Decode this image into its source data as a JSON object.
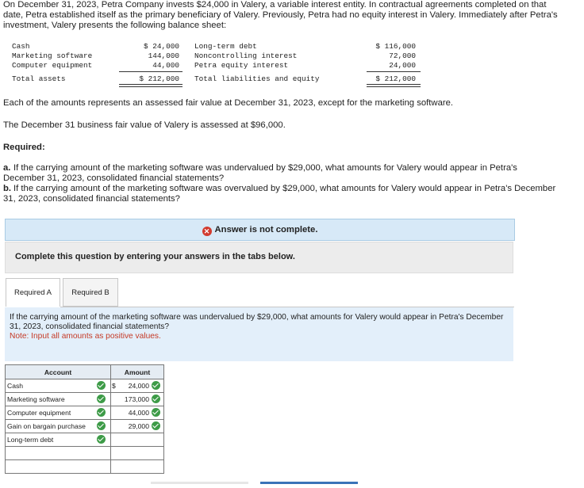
{
  "intro": "On December 31, 2023, Petra Company invests $24,000 in Valery, a variable interest entity. In contractual agreements completed on that date, Petra established itself as the primary beneficiary of Valery. Previously, Petra had no equity interest in Valery. Immediately after Petra's investment, Valery presents the following balance sheet:",
  "balance_sheet": {
    "assets": [
      {
        "label": "Cash",
        "value": "$ 24,000"
      },
      {
        "label": "Marketing software",
        "value": "144,000"
      },
      {
        "label": "Computer equipment",
        "value": "44,000"
      }
    ],
    "total_assets_label": "Total assets",
    "total_assets": "$ 212,000",
    "liabilities": [
      {
        "label": "Long-term debt",
        "value": "$ 116,000"
      },
      {
        "label": "Noncontrolling interest",
        "value": "72,000"
      },
      {
        "label": "Petra equity interest",
        "value": "24,000"
      }
    ],
    "total_liab_label": "Total liabilities and equity",
    "total_liab": "$ 212,000"
  },
  "para1": "Each of the amounts represents an assessed fair value at December 31, 2023, except for the marketing software.",
  "para2": "The December 31 business fair value of Valery is assessed at $96,000.",
  "required_heading": "Required:",
  "req_a_letter": "a.",
  "req_a": "If the carrying amount of the marketing software was undervalued by $29,000, what amounts for Valery would appear in Petra's December 31, 2023, consolidated financial statements?",
  "req_b_letter": "b.",
  "req_b": "If the carrying amount of the marketing software was overvalued by $29,000, what amounts for Valery would appear in Petra's December 31, 2023, consolidated financial statements?",
  "banner": "Answer is not complete.",
  "instruction": "Complete this question by entering your answers in the tabs below.",
  "tabs": [
    "Required A",
    "Required B"
  ],
  "question": "If the carrying amount of the marketing software was undervalued by $29,000, what amounts for Valery would appear in Petra's December 31, 2023, consolidated financial statements?",
  "note": "Note: Input all amounts as positive values.",
  "table": {
    "headers": [
      "Account",
      "Amount"
    ],
    "rows": [
      {
        "account": "Cash",
        "dollar": "$",
        "amount": "24,000",
        "acct_check": true,
        "amt_check": true
      },
      {
        "account": "Marketing software",
        "dollar": "",
        "amount": "173,000",
        "acct_check": true,
        "amt_check": true
      },
      {
        "account": "Computer equipment",
        "dollar": "",
        "amount": "44,000",
        "acct_check": true,
        "amt_check": true
      },
      {
        "account": "Gain on bargain purchase",
        "dollar": "",
        "amount": "29,000",
        "acct_check": true,
        "amt_check": true
      },
      {
        "account": "Long-term debt",
        "dollar": "",
        "amount": "",
        "acct_check": true,
        "amt_check": false
      },
      {
        "account": "",
        "dollar": "",
        "amount": "",
        "acct_check": false,
        "amt_check": false
      },
      {
        "account": "",
        "dollar": "",
        "amount": "",
        "acct_check": false,
        "amt_check": false
      }
    ]
  },
  "colors": {
    "check": "#3d9b47",
    "error": "#d23b2f",
    "banner_bg": "#d7e9f7",
    "note": "#c53a26"
  }
}
